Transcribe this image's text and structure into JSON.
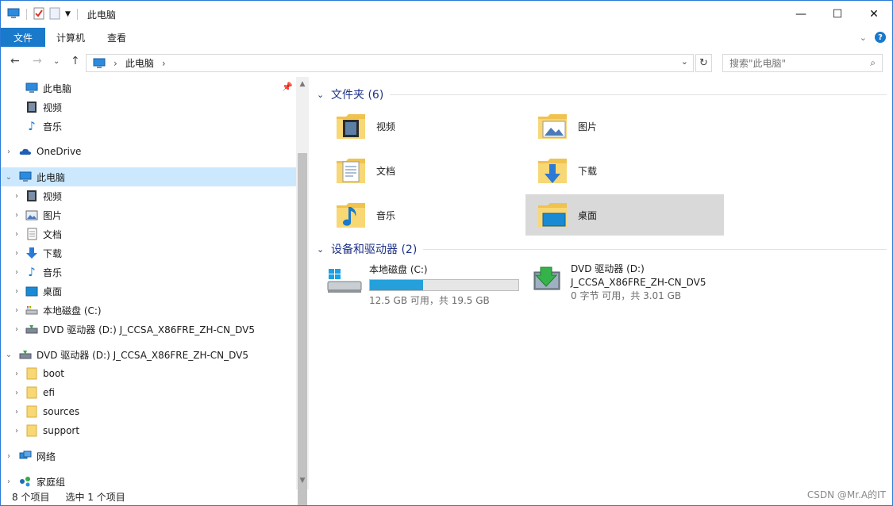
{
  "window": {
    "title": "此电脑",
    "controls": {
      "minimize": "—",
      "maximize": "☐",
      "close": "✕"
    }
  },
  "ribbon": {
    "tabs": [
      "文件",
      "计算机",
      "查看"
    ],
    "help_label": "?"
  },
  "address": {
    "crumb": "此电脑",
    "search_placeholder": "搜索\"此电脑\""
  },
  "nav": {
    "quick": [
      {
        "label": "此电脑",
        "icon": "pc-icon"
      },
      {
        "label": "视频",
        "icon": "video-icon"
      },
      {
        "label": "音乐",
        "icon": "music-icon"
      }
    ],
    "onedrive": "OneDrive",
    "this_pc": "此电脑",
    "this_pc_children": [
      {
        "label": "视频",
        "icon": "video-icon"
      },
      {
        "label": "图片",
        "icon": "pictures-icon"
      },
      {
        "label": "文档",
        "icon": "documents-icon"
      },
      {
        "label": "下载",
        "icon": "download-icon"
      },
      {
        "label": "音乐",
        "icon": "music-icon"
      },
      {
        "label": "桌面",
        "icon": "desktop-icon"
      },
      {
        "label": "本地磁盘 (C:)",
        "icon": "drive-icon"
      },
      {
        "label": "DVD 驱动器 (D:) J_CCSA_X86FRE_ZH-CN_DV5",
        "icon": "dvd-icon"
      }
    ],
    "dvd": "DVD 驱动器 (D:) J_CCSA_X86FRE_ZH-CN_DV5",
    "dvd_children": [
      "boot",
      "efi",
      "sources",
      "support"
    ],
    "network": "网络",
    "homegroup": "家庭组"
  },
  "content": {
    "folders_title": "文件夹 (6)",
    "folders": [
      {
        "label": "视频",
        "icon": "video-folder-icon"
      },
      {
        "label": "图片",
        "icon": "pictures-folder-icon"
      },
      {
        "label": "文档",
        "icon": "documents-folder-icon"
      },
      {
        "label": "下载",
        "icon": "download-folder-icon"
      },
      {
        "label": "音乐",
        "icon": "music-folder-icon"
      },
      {
        "label": "桌面",
        "icon": "desktop-folder-icon",
        "selected": true
      }
    ],
    "devices_title": "设备和驱动器 (2)",
    "drives": [
      {
        "name": "本地磁盘 (C:)",
        "usage": "12.5 GB 可用，共 19.5 GB",
        "used_fraction": 0.36
      },
      {
        "name": "DVD 驱动器 (D:)",
        "label2": "J_CCSA_X86FRE_ZH-CN_DV5",
        "usage": "0 字节 可用，共 3.01 GB"
      }
    ]
  },
  "status": {
    "count": "8 个项目",
    "selected": "选中 1 个项目",
    "watermark": "CSDN @Mr.A的IT"
  },
  "colors": {
    "accent": "#1979ca",
    "selection": "#cce8ff",
    "group_title": "#1e3287",
    "bar_fill": "#26a0da"
  }
}
